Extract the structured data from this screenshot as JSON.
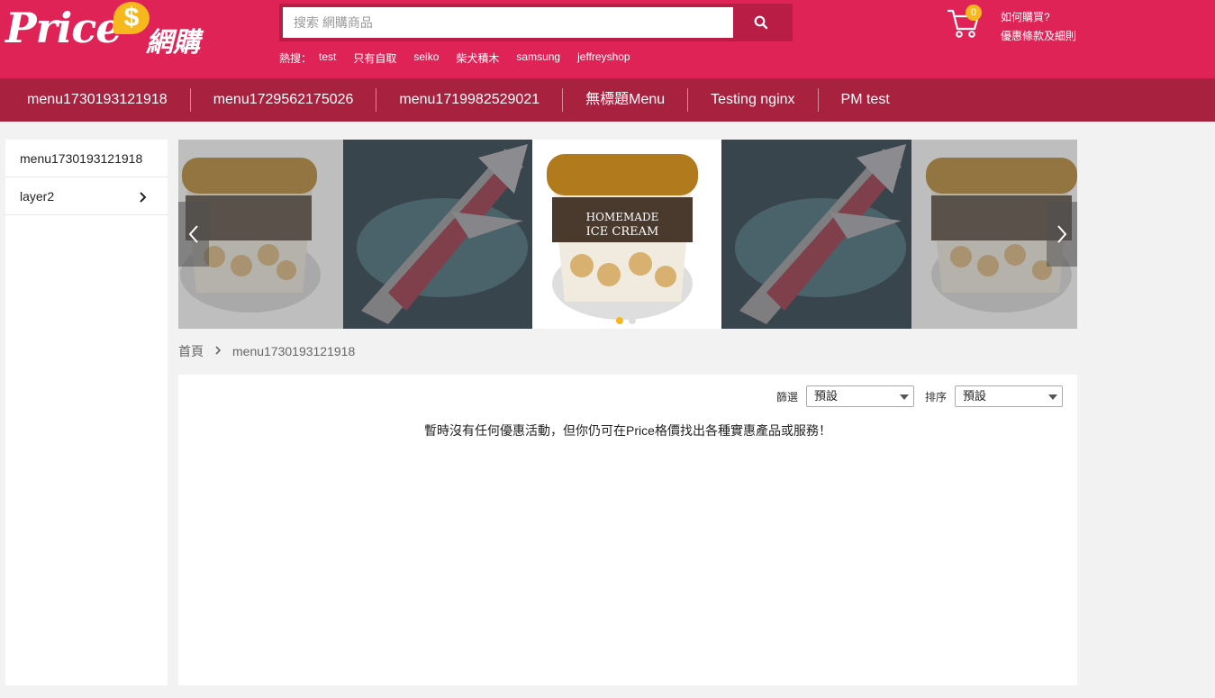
{
  "header": {
    "logo": {
      "price": "Price",
      "dollar": "$",
      "cn": "網購"
    },
    "search": {
      "placeholder": "搜索 網購商品",
      "value": ""
    },
    "hot_label": "熱搜：",
    "hot_terms": [
      "test",
      "只有自取",
      "seiko",
      "柴犬積木",
      "samsung",
      "jeffreyshop"
    ],
    "cart_count": "0",
    "help_links": [
      "如何購買?",
      "優惠條款及細則"
    ]
  },
  "nav": [
    "menu1730193121918",
    "menu1729562175026",
    "menu1719982529021",
    "無標題Menu",
    "Testing nginx",
    "PM test"
  ],
  "sidebar": {
    "items": [
      {
        "label": "menu1730193121918",
        "has_children": false
      },
      {
        "label": "layer2",
        "has_children": true
      }
    ]
  },
  "carousel": {
    "slides": [
      "ice-cream",
      "weapon",
      "ice-cream",
      "weapon",
      "ice-cream"
    ],
    "active_slide": 1,
    "dot_count": 2,
    "active_dot": 0
  },
  "breadcrumb": [
    "首頁",
    "menu1730193121918"
  ],
  "content": {
    "filter_label": "篩選",
    "filter_value": "預設",
    "sort_label": "排序",
    "sort_value": "預設",
    "empty_message": "暫時沒有任何優惠活動，但你仍可在Price格價找出各種實惠產品或服務！"
  },
  "colors": {
    "brand": "#e02356",
    "nav": "#a8213f",
    "accent": "#f6b81c"
  }
}
